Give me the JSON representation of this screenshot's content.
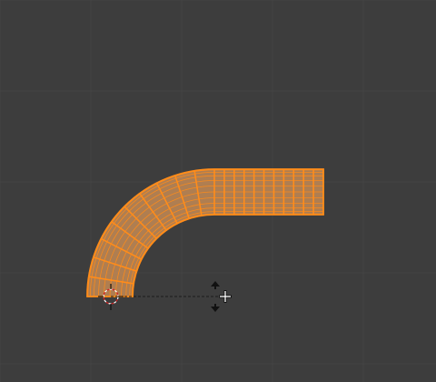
{
  "viewport": {
    "background": "#3d3d3d",
    "grid_color": "#444444",
    "mode": "edit-mesh"
  },
  "mesh": {
    "shape": "bent-tube",
    "selected": true,
    "fill_color": "#c38a55",
    "edge_color": "#ff8c1a",
    "ring_count_straight": 11,
    "ring_count_bend": 10
  },
  "tools": {
    "cursor_icon": "3d-cursor-icon",
    "transform_icon": "move-arrows-icon",
    "crosshair_icon": "crosshair-icon"
  }
}
